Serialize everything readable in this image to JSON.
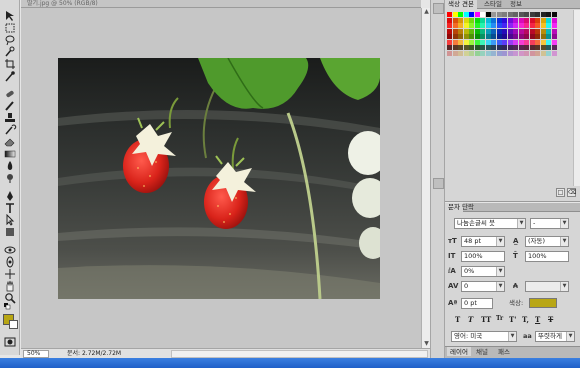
{
  "document": {
    "title": "딸기.jpg @ 50% (RGB/8)",
    "zoom": "50%",
    "status": "문서: 2.72M/2.72M"
  },
  "toolbox": {
    "tools": [
      "move-tool",
      "marquee-tool",
      "lasso-tool",
      "quick-select-tool",
      "crop-tool",
      "eyedropper-tool",
      "healing-tool",
      "brush-tool",
      "stamp-tool",
      "history-brush-tool",
      "eraser-tool",
      "gradient-tool",
      "blur-tool",
      "dodge-tool",
      "pen-tool",
      "type-tool",
      "path-select-tool",
      "shape-tool",
      "3d-rotate-tool",
      "3d-orbit-tool",
      "hand-tool",
      "zoom-tool"
    ],
    "foreground_color": "#b8a614",
    "background_color": "#ffffff"
  },
  "swatches_panel": {
    "tabs": [
      "색상 견본",
      "스타일",
      "정보"
    ],
    "active_tab": "색상 견본"
  },
  "character_panel": {
    "tabs": [
      "문자",
      "단락"
    ],
    "active_tab": "문자",
    "font_family": "나눔손글씨 붓",
    "font_style": "-",
    "font_size": "48 pt",
    "leading": "(자동)",
    "vertical_scale": "100%",
    "horizontal_scale": "100%",
    "tracking_ratio": "0%",
    "tracking": "0",
    "kerning": "",
    "baseline_shift": "0 pt",
    "color_label": "색상:",
    "color": "#b8a614",
    "type_styles": [
      "T",
      "T",
      "TT",
      "Tr",
      "T'",
      "T,",
      "T",
      "T"
    ],
    "language": "영어: 미국",
    "antialias_icon": "aa",
    "antialias": "뚜렷하게"
  },
  "layers_panel": {
    "tabs": [
      "레이어",
      "채널",
      "패스"
    ]
  },
  "colors": {
    "canvas_bg": "#c6c6c6",
    "panel_bg": "#d6d6d6",
    "accent_swatch": "#b8a614"
  }
}
